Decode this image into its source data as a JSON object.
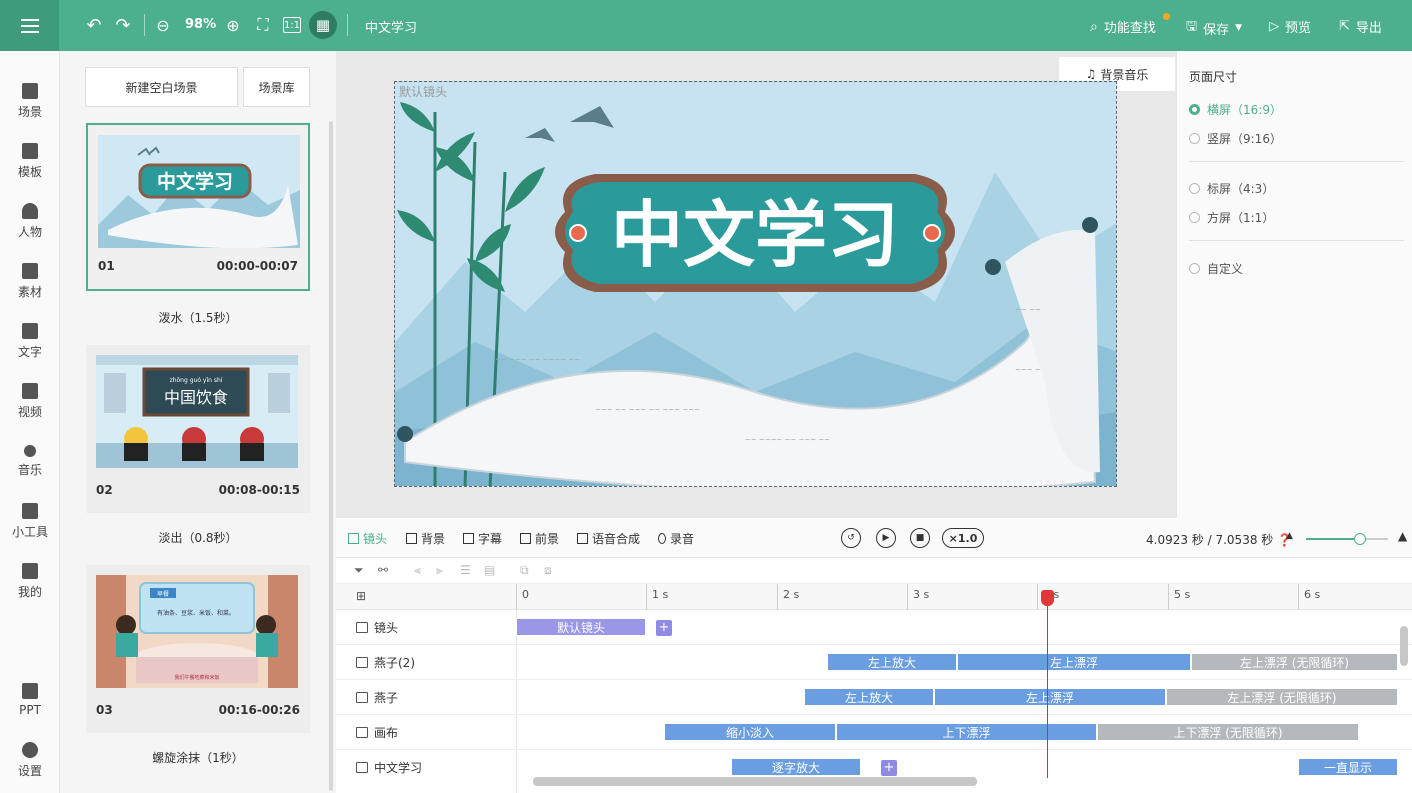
{
  "topbar": {
    "zoom": "98%",
    "doc_title": "中文学习",
    "feature_search": "功能查找",
    "save": "保存",
    "preview": "预览",
    "export": "导出"
  },
  "leftnav": {
    "items": [
      {
        "label": "场景",
        "icon": "scene-icon"
      },
      {
        "label": "模板",
        "icon": "template-icon"
      },
      {
        "label": "人物",
        "icon": "person-icon"
      },
      {
        "label": "素材",
        "icon": "material-icon"
      },
      {
        "label": "文字",
        "icon": "text-icon"
      },
      {
        "label": "视频",
        "icon": "video-icon"
      },
      {
        "label": "音乐",
        "icon": "music-icon"
      },
      {
        "label": "小工具",
        "icon": "toolbox-icon"
      },
      {
        "label": "我的",
        "icon": "upload-icon"
      },
      {
        "label": "PPT",
        "icon": "ppt-icon"
      },
      {
        "label": "设置",
        "icon": "gear-icon"
      }
    ]
  },
  "scenes": {
    "new_blank": "新建空白场景",
    "library": "场景库",
    "list": [
      {
        "num": "01",
        "time": "00:00-00:07",
        "transition": "泼水（1.5秒）",
        "thumb_title": "中文学习"
      },
      {
        "num": "02",
        "time": "00:08-00:15",
        "transition": "淡出（0.8秒）",
        "thumb_title": "中国饮食",
        "thumb_pinyin": "zhōng  guó  yǐn  shí"
      },
      {
        "num": "03",
        "time": "00:16-00:26",
        "transition": "螺旋涂抹（1秒）",
        "thumb_title": "早餐",
        "thumb_text": "有油条、豆浆、米饭、和菜。",
        "thumb_caption": "我们午餐吃菜和米饭"
      }
    ]
  },
  "canvas": {
    "camera_label": "默认镜头",
    "bgm": "背景音乐",
    "title": "中文学习"
  },
  "page_size": {
    "title": "页面尺寸",
    "options": [
      {
        "label": "横屏（16:9）",
        "selected": true
      },
      {
        "label": "竖屏（9:16）",
        "selected": false
      },
      {
        "label": "标屏（4:3）",
        "selected": false
      },
      {
        "label": "方屏（1:1）",
        "selected": false
      },
      {
        "label": "自定义",
        "selected": false
      }
    ]
  },
  "timeline": {
    "tabs": [
      {
        "label": "镜头",
        "active": true
      },
      {
        "label": "背景",
        "active": false
      },
      {
        "label": "字幕",
        "active": false
      },
      {
        "label": "前景",
        "active": false
      },
      {
        "label": "语音合成",
        "active": false
      },
      {
        "label": "录音",
        "active": false
      }
    ],
    "speed": "×1.0",
    "time": "4.0923 秒 / 7.0538 秒",
    "ruler": [
      "0",
      "1 s",
      "2 s",
      "3 s",
      "4 s",
      "5 s",
      "6 s"
    ],
    "tracks": [
      {
        "label": "镜头",
        "clips": [
          "默认镜头"
        ]
      },
      {
        "label": "燕子(2)",
        "clips": [
          "左上放大",
          "左上漂浮",
          "左上漂浮 (无限循环)"
        ]
      },
      {
        "label": "燕子",
        "clips": [
          "左上放大",
          "左上漂浮",
          "左上漂浮 (无限循环)"
        ]
      },
      {
        "label": "画布",
        "clips": [
          "缩小淡入",
          "上下漂浮",
          "上下漂浮 (无限循环)"
        ]
      },
      {
        "label": "中文学习",
        "clips": [
          "逐字放大",
          "一直显示"
        ]
      }
    ]
  },
  "colors": {
    "accent": "#4caf8e",
    "clip_blue": "#6a9ee0",
    "clip_gray": "#b5b8bd",
    "playhead": "#e02b2b"
  }
}
